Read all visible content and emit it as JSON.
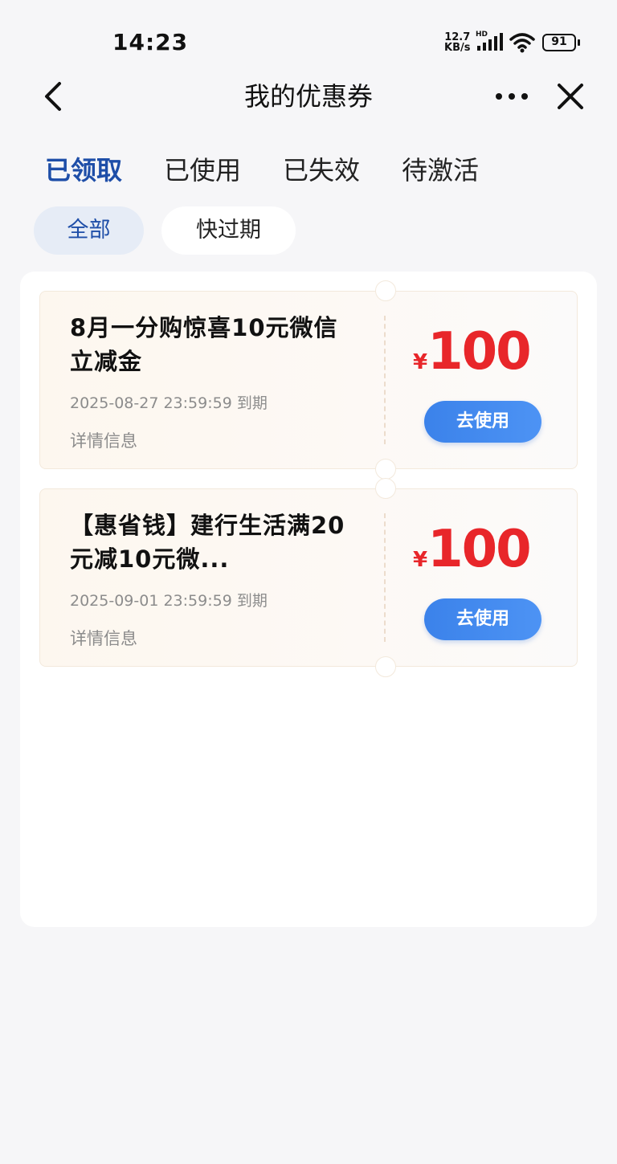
{
  "status_bar": {
    "time": "14:23",
    "net_speed_value": "12.7",
    "net_speed_unit": "KB/s",
    "signal_label": "HD",
    "battery": "91"
  },
  "nav": {
    "title": "我的优惠券",
    "back_icon": "chevron-left-icon",
    "more_icon": "more-horizontal-icon",
    "close_icon": "close-icon"
  },
  "tabs": [
    {
      "label": "已领取",
      "active": true
    },
    {
      "label": "已使用",
      "active": false
    },
    {
      "label": "已失效",
      "active": false
    },
    {
      "label": "待激活",
      "active": false
    }
  ],
  "filters": [
    {
      "label": "全部",
      "active": true
    },
    {
      "label": "快过期",
      "active": false
    }
  ],
  "coupons": [
    {
      "title": "8月一分购惊喜10元微信立减金",
      "expiry": "2025-08-27 23:59:59 到期",
      "details_label": "详情信息",
      "currency": "¥",
      "amount": "100",
      "button_label": "去使用"
    },
    {
      "title": "【惠省钱】建行生活满20元减10元微...",
      "expiry": "2025-09-01 23:59:59 到期",
      "details_label": "详情信息",
      "currency": "¥",
      "amount": "100",
      "button_label": "去使用"
    }
  ],
  "colors": {
    "accent": "#1e4ea8",
    "price": "#e8262a",
    "button": "#3b82ea"
  }
}
